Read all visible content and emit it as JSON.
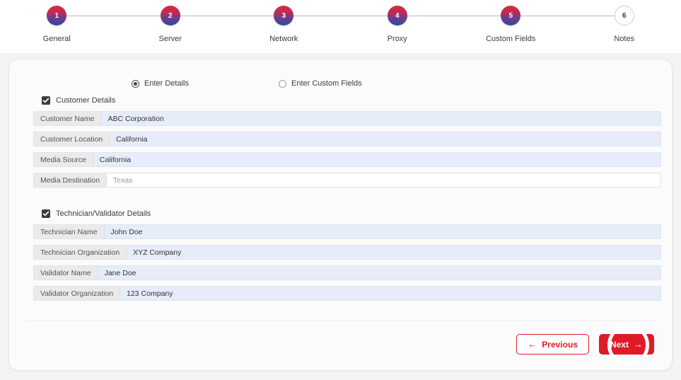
{
  "stepper": {
    "steps": [
      {
        "num": "1",
        "label": "General",
        "state": "active"
      },
      {
        "num": "2",
        "label": "Server",
        "state": "active"
      },
      {
        "num": "3",
        "label": "Network",
        "state": "active"
      },
      {
        "num": "4",
        "label": "Proxy",
        "state": "active"
      },
      {
        "num": "5",
        "label": "Custom Fields",
        "state": "active"
      },
      {
        "num": "6",
        "label": "Notes",
        "state": "inactive"
      }
    ]
  },
  "mode_options": {
    "details_label": "Enter Details",
    "custom_label": "Enter Custom Fields",
    "selected": "Enter Details"
  },
  "customer_section": {
    "title": "Customer Details",
    "checked": true,
    "fields": [
      {
        "label": "Customer Name",
        "value": "ABC Corporation",
        "placeholder": ""
      },
      {
        "label": "Customer Location",
        "value": "California",
        "placeholder": ""
      },
      {
        "label": "Media Source",
        "value": "California",
        "placeholder": ""
      },
      {
        "label": "Media Destination",
        "value": "",
        "placeholder": "Texas"
      }
    ]
  },
  "technician_section": {
    "title": "Technician/Validator Details",
    "checked": true,
    "fields": [
      {
        "label": "Technician Name",
        "value": "John Doe",
        "placeholder": ""
      },
      {
        "label": "Technician Organization",
        "value": "XYZ Company",
        "placeholder": ""
      },
      {
        "label": "Validator Name",
        "value": "Jane Doe",
        "placeholder": ""
      },
      {
        "label": "Validator Organization",
        "value": "123 Company",
        "placeholder": ""
      }
    ]
  },
  "footer": {
    "previous_label": "Previous",
    "previous_arrow": "←",
    "next_label": "Next",
    "next_arrow": "→"
  },
  "colors": {
    "accent_red": "#e01b28",
    "step_gradient_top": "#d42e3f",
    "step_gradient_bottom": "#2c4a9c",
    "field_fill": "#e7ecfa",
    "label_fill": "#eaeaea"
  }
}
